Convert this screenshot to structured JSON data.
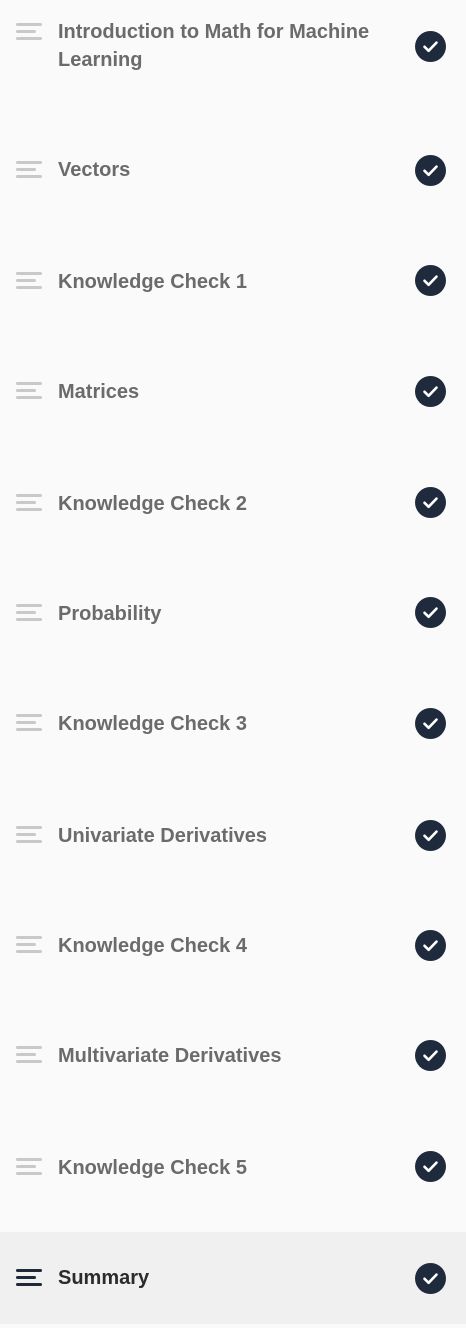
{
  "lessons": [
    {
      "title": "Introduction to Math for Machine Learning",
      "completed": true
    },
    {
      "title": "Vectors",
      "completed": true
    },
    {
      "title": "Knowledge Check 1",
      "completed": true
    },
    {
      "title": "Matrices",
      "completed": true
    },
    {
      "title": "Knowledge Check 2",
      "completed": true
    },
    {
      "title": "Probability",
      "completed": true
    },
    {
      "title": "Knowledge Check 3",
      "completed": true
    },
    {
      "title": "Univariate Derivatives",
      "completed": true
    },
    {
      "title": "Knowledge Check 4",
      "completed": true
    },
    {
      "title": "Multivariate Derivatives",
      "completed": true
    },
    {
      "title": "Knowledge Check 5",
      "completed": true
    },
    {
      "title": "Summary",
      "completed": true,
      "active": true
    }
  ],
  "icons": {
    "lesson_icon": "lines-icon",
    "status_icon": "check-circle-icon"
  },
  "colors": {
    "background": "#fafafa",
    "active_background": "#f0f0f0",
    "check_fill": "#1f2b3d",
    "inactive_text": "#6b6b6b",
    "active_text": "#2b2b2b"
  }
}
